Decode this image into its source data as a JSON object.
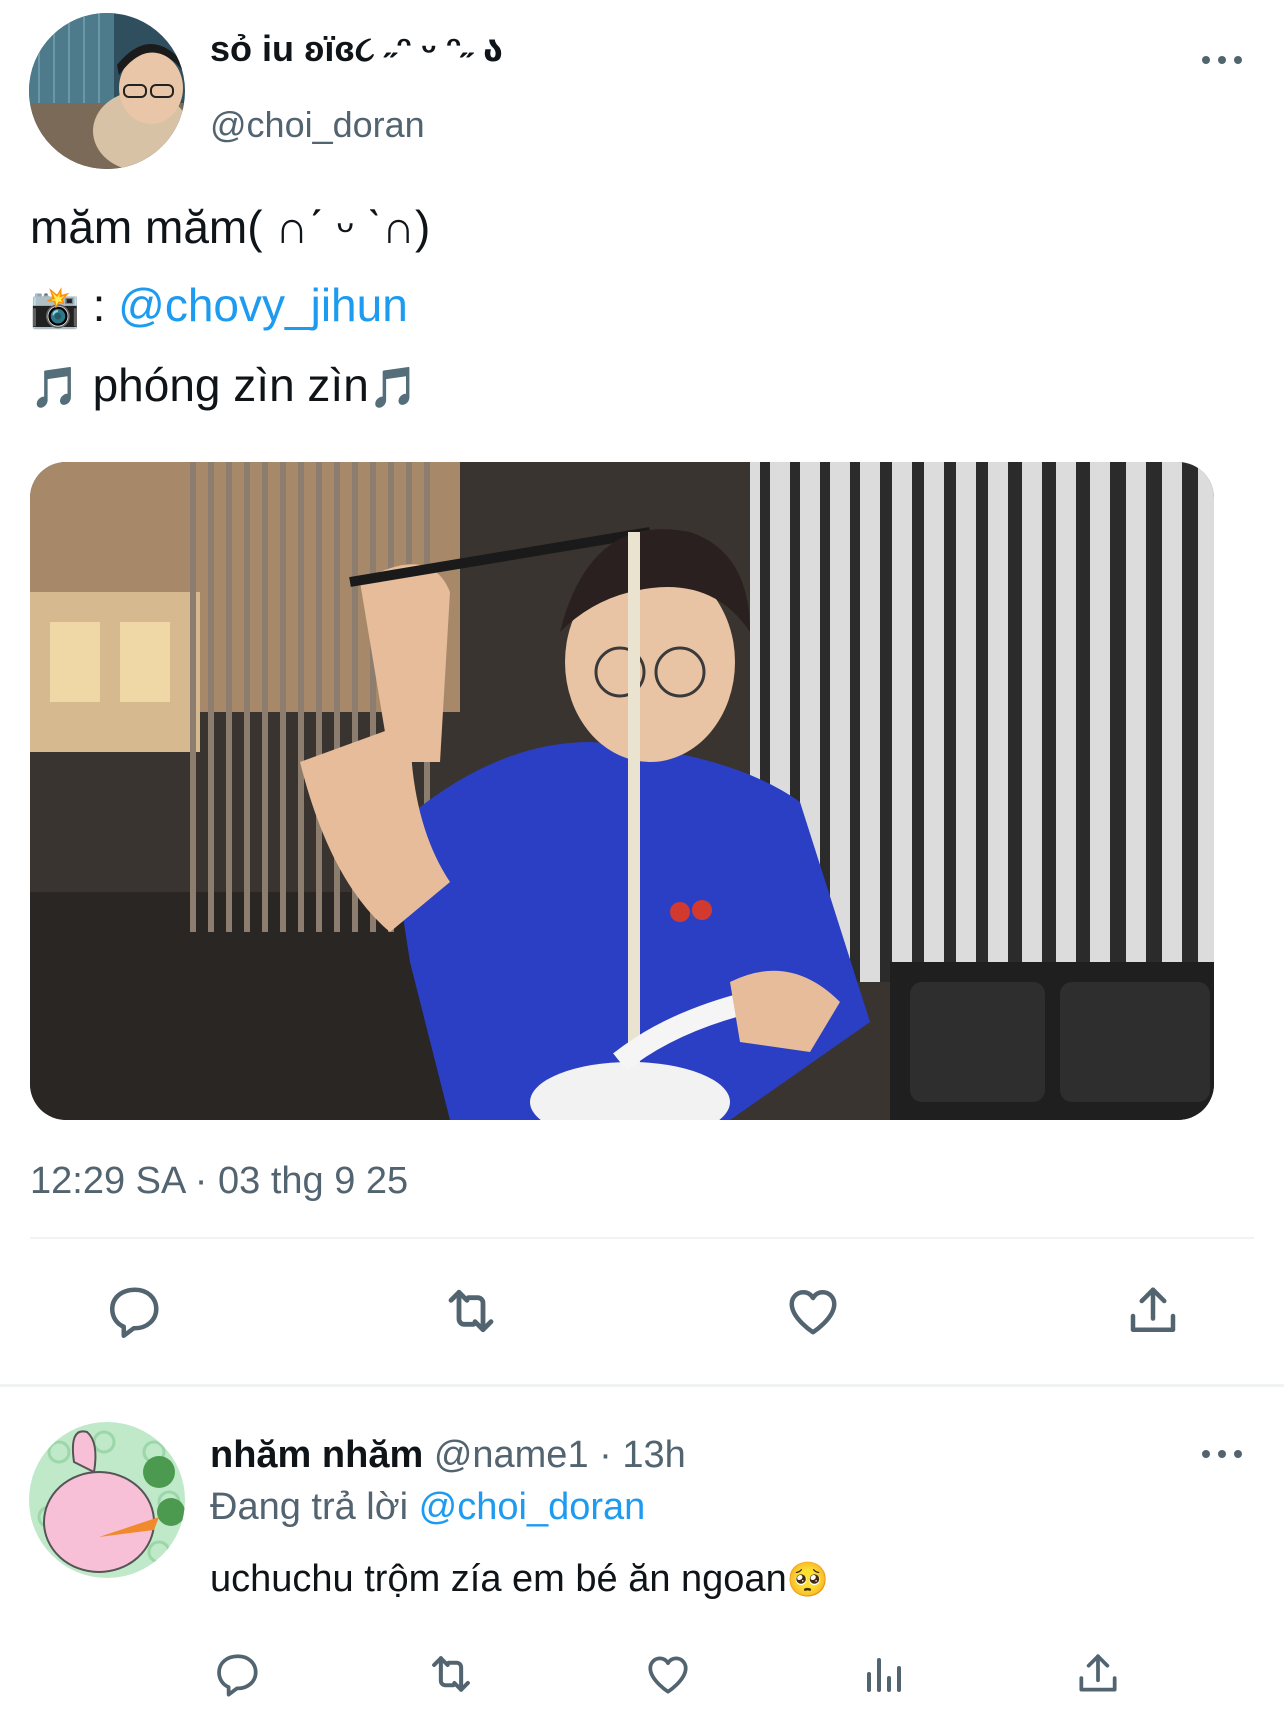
{
  "tweet": {
    "display_name": "sỏ iu ʚïɞ૮ ˶ᵔ ᵕ ᵔ˶ ა",
    "handle": "@choi_doran",
    "text_line1": "măm măm( ∩ˊ ᵕ ˋ∩)",
    "camera_emoji": "📸",
    "photo_credit_sep": ":",
    "photo_credit_handle": "@chovy_jihun",
    "music_note_left": "🎵",
    "text_line3": "phóng zìn zìn",
    "music_note_right": "🎵",
    "timestamp": "12:29 SA · 03 thg 9 25"
  },
  "reply": {
    "display_name": "nhăm nhăm",
    "handle": "@name1",
    "sep": "·",
    "time": "13h",
    "replying_to_prefix": "Đang trả lời",
    "replying_to_handle": "@choi_doran",
    "text": "uchuchu trộm zía em bé ăn ngoan",
    "emoji": "🥺"
  },
  "icons": {
    "reply": "reply-icon",
    "retweet": "retweet-icon",
    "like": "heart-icon",
    "views": "views-icon",
    "share": "share-icon",
    "more": "more-icon"
  },
  "colors": {
    "text": "#0f1419",
    "muted": "#536471",
    "link": "#1d9bf0",
    "divider": "#eff3f4"
  }
}
